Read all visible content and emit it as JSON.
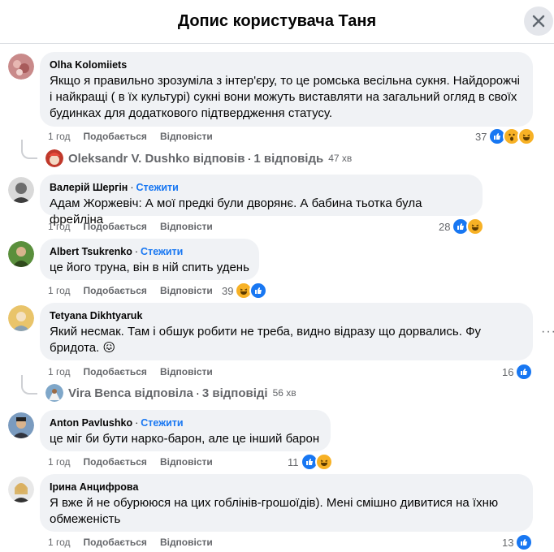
{
  "header": {
    "title": "Допис користувача Таня"
  },
  "actions": {
    "like": "Подобається",
    "reply": "Відповісти"
  },
  "comments": [
    {
      "author": "Olha Kolomiiets",
      "follow": "",
      "text": "Якщо я правильно зрозуміла з інтер'єру, то це ромська весільна сукня. Найдорожчі і найкращі ( в їх культурі) сукні вони можуть виставляти на загальний огляд в своїх будинках для додаткового підтвердження статусу.",
      "time": "1 год",
      "reactions": {
        "count": "37",
        "icons": [
          "like-icon",
          "wow-icon",
          "haha-icon"
        ]
      },
      "reply": {
        "name": "Oleksandr V. Dushko відповів",
        "count": "1 відповідь",
        "time": "47 хв"
      }
    },
    {
      "author": "Валерій Шергін",
      "follow": "Стежити",
      "text": "Адам Жоржевіч: А мої предкі були дворянє. А бабина тьотка була фрейліна",
      "time": "1 год",
      "reactions": {
        "count": "28",
        "icons": [
          "like-icon",
          "haha-icon"
        ]
      }
    },
    {
      "author": "Albert Tsukrenko",
      "follow": "Стежити",
      "text": "це його труна, він в ній спить удень",
      "time": "1 год",
      "reactions": {
        "count": "39",
        "icons": [
          "haha-icon",
          "like-icon"
        ]
      }
    },
    {
      "author": "Tetyana Dikhtyaruk",
      "follow": "",
      "text": "Який несмак. Там і обшук робити не треба, видно відразу що дорвались. Фу бридота. 😖",
      "time": "1 год",
      "reactions": {
        "count": "16",
        "icons": [
          "like-icon"
        ]
      },
      "reply": {
        "name": "Vira Benca відповіла",
        "count": "3 відповіді",
        "time": "56 хв"
      }
    },
    {
      "author": "Anton Pavlushko",
      "follow": "Стежити",
      "text": "це міг би бути нарко-барон, але це інший барон",
      "time": "1 год",
      "reactions": {
        "count": "11",
        "icons": [
          "like-icon",
          "haha-icon"
        ]
      }
    },
    {
      "author": "Ірина Анцифрова",
      "follow": "",
      "text": "Я вже й не обурююся на цих гоблінів-грошоїдів). Мені смішно дивитися на їхню обмеженість",
      "time": "1 год",
      "reactions": {
        "count": "13",
        "icons": [
          "like-icon"
        ]
      }
    }
  ],
  "colors": {
    "accent": "#1877f2",
    "bubble": "#f0f2f5",
    "muted": "#65676b"
  }
}
